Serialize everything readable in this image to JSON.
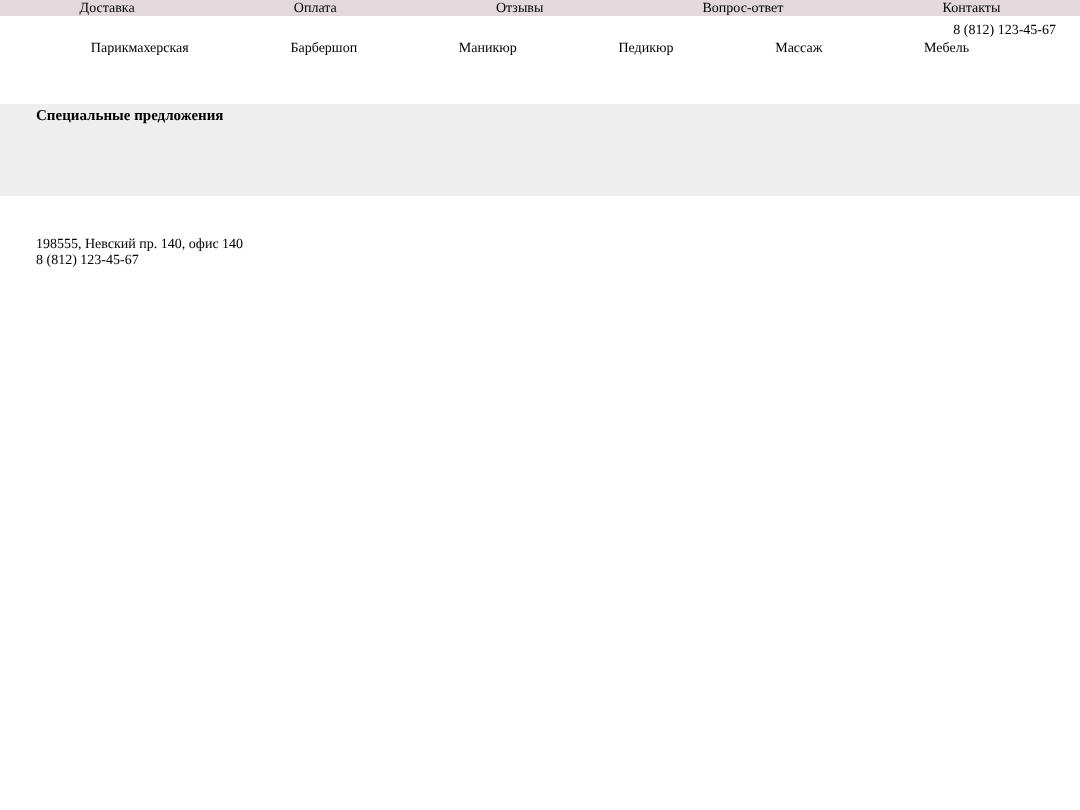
{
  "top_menu": [
    "Доставка",
    "Оплата",
    "Отзывы",
    "Вопрос-ответ",
    "Контакты"
  ],
  "header_phone": "8 (812) 123-45-67",
  "categories": [
    "Парикмахерская",
    "Барбершоп",
    "Маникюр",
    "Педикюр",
    "Массаж",
    "Мебель"
  ],
  "special_offers": {
    "title": "Специальные предложения"
  },
  "footer": {
    "address": "198555, Невский пр. 140, офис 140",
    "phone": "8 (812) 123-45-67"
  }
}
